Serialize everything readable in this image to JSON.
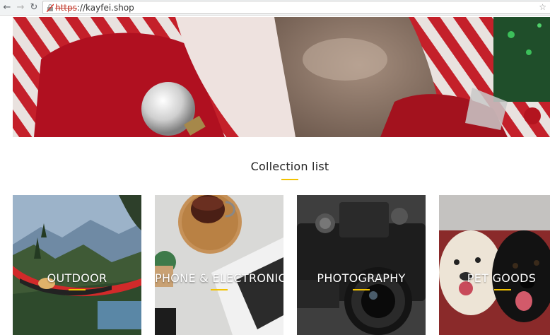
{
  "browser": {
    "url_scheme": "https",
    "url_rest": "://kayfei.shop",
    "back_icon": "arrow-left-icon",
    "forward_icon": "arrow-right-icon",
    "reload_icon": "reload-icon",
    "star_icon": "bookmark-star-icon"
  },
  "collection": {
    "title": "Collection list",
    "accent_color": "#f2c200",
    "items": [
      {
        "label": "OUTDOOR"
      },
      {
        "label": "PHONE & ELECTRONIC"
      },
      {
        "label": "PHOTOGRAPHY"
      },
      {
        "label": "PET GOODS"
      }
    ]
  }
}
